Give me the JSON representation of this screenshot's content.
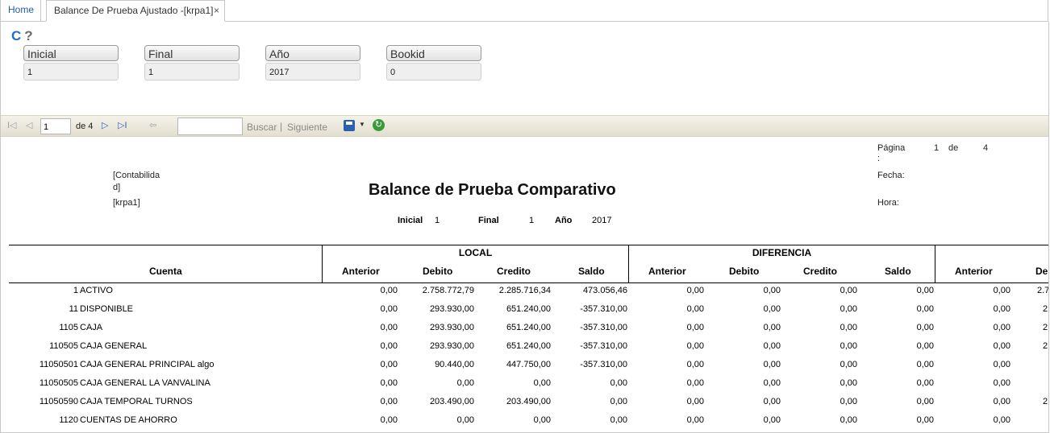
{
  "tabs": {
    "home": "Home",
    "active": "Balance De Prueba Ajustado -[krpa1]",
    "close": "×"
  },
  "toolbar_icons": [
    "refresh-icon",
    "help-icon"
  ],
  "toolbar_glyphs": {
    "refresh": "C",
    "help": "?"
  },
  "params": [
    {
      "label": "Inicial",
      "value": "1"
    },
    {
      "label": "Final",
      "value": "1"
    },
    {
      "label": "Año",
      "value": "2017"
    },
    {
      "label": "Bookid",
      "value": "0"
    }
  ],
  "report_toolbar": {
    "first_glyph": "I◁",
    "prev_glyph": "◁",
    "next_glyph": "▷",
    "last_glyph": "▷I",
    "back_glyph": "⇦",
    "page": "1",
    "of_total": "de 4",
    "search_label": "Buscar",
    "separator": "|",
    "next_label": "Siguiente",
    "dropdown_glyph": "▼",
    "refresh_glyph": "↻"
  },
  "report": {
    "company_line1": "[Contabilida",
    "company_line2": "d]",
    "company_code": "[krpa1]",
    "title": "Balance de Prueba Comparativo",
    "page_label": "Página",
    "page_colon": ":",
    "page_num": "1",
    "page_de": "de",
    "page_total": "4",
    "fecha_label": "Fecha:",
    "hora_label": "Hora:",
    "inicial_label": "Inicial",
    "inicial_value": "1",
    "final_label": "Final",
    "final_value": "1",
    "anio_label": "Año",
    "anio_value": "2017",
    "group_local": "LOCAL",
    "group_diferencia": "DIFERENCIA",
    "col_cuenta": "Cuenta",
    "cols": [
      "Anterior",
      "Debito",
      "Credito",
      "Saldo",
      "Anterior",
      "Debito",
      "Credito",
      "Saldo",
      "Anterior",
      "De"
    ],
    "rows": [
      {
        "code": "1",
        "name": "ACTIVO",
        "vals": [
          "0,00",
          "2.758.772,79",
          "2.285.716,34",
          "473.056,46",
          "0,00",
          "0,00",
          "0,00",
          "0,00",
          "0,00",
          "2.7"
        ]
      },
      {
        "code": "11",
        "name": "DISPONIBLE",
        "vals": [
          "0,00",
          "293.930,00",
          "651.240,00",
          "-357.310,00",
          "0,00",
          "0,00",
          "0,00",
          "0,00",
          "0,00",
          "2"
        ]
      },
      {
        "code": "1105",
        "name": "CAJA",
        "vals": [
          "0,00",
          "293.930,00",
          "651.240,00",
          "-357.310,00",
          "0,00",
          "0,00",
          "0,00",
          "0,00",
          "0,00",
          "2"
        ]
      },
      {
        "code": "110505",
        "name": "CAJA GENERAL",
        "vals": [
          "0,00",
          "293.930,00",
          "651.240,00",
          "-357.310,00",
          "0,00",
          "0,00",
          "0,00",
          "0,00",
          "0,00",
          "2"
        ]
      },
      {
        "code": "11050501",
        "name": "CAJA GENERAL PRINCIPAL algo",
        "vals": [
          "0,00",
          "90.440,00",
          "447.750,00",
          "-357.310,00",
          "0,00",
          "0,00",
          "0,00",
          "0,00",
          "0,00",
          ""
        ]
      },
      {
        "code": "11050505",
        "name": "CAJA GENERAL LA VANVALINA",
        "vals": [
          "0,00",
          "0,00",
          "0,00",
          "0,00",
          "0,00",
          "0,00",
          "0,00",
          "0,00",
          "0,00",
          ""
        ]
      },
      {
        "code": "11050590",
        "name": "CAJA TEMPORAL TURNOS",
        "vals": [
          "0,00",
          "203.490,00",
          "203.490,00",
          "0,00",
          "0,00",
          "0,00",
          "0,00",
          "0,00",
          "0,00",
          "2"
        ]
      },
      {
        "code": "1120",
        "name": "CUENTAS DE AHORRO",
        "vals": [
          "0,00",
          "0,00",
          "0,00",
          "0,00",
          "0,00",
          "0,00",
          "0,00",
          "0,00",
          "0,00",
          ""
        ]
      }
    ]
  }
}
